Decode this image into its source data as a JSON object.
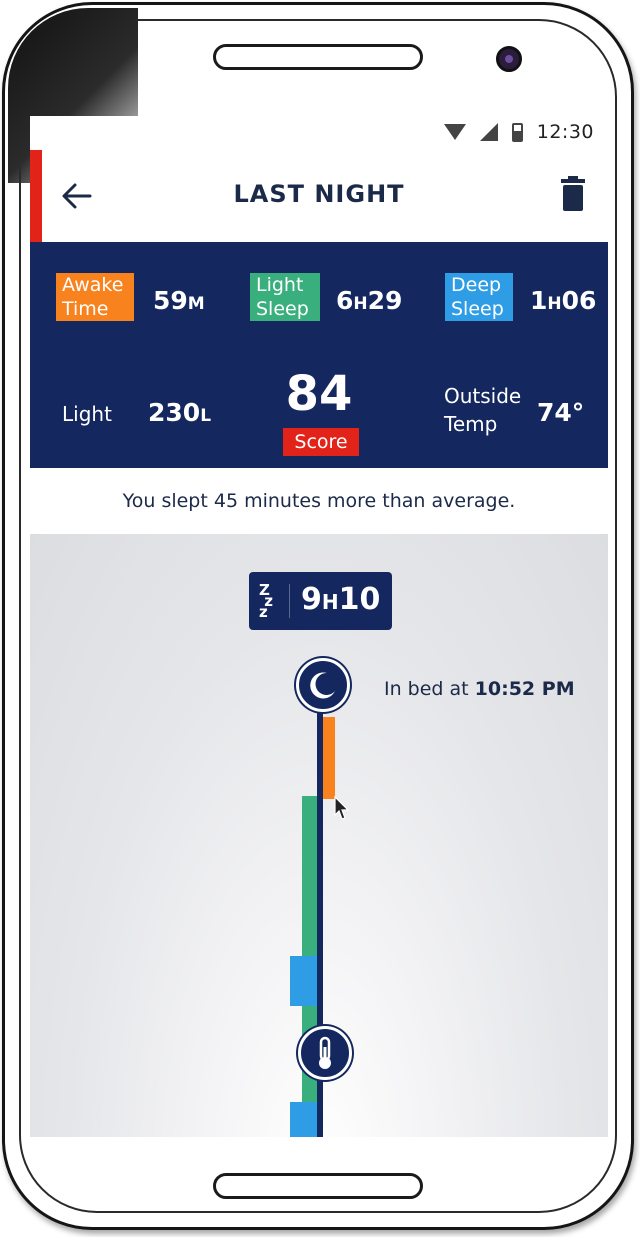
{
  "status_bar": {
    "time": "12:30"
  },
  "app_bar": {
    "title": "LAST NIGHT"
  },
  "stats": {
    "awake": {
      "label_line1": "Awake",
      "label_line2": "Time",
      "value": "59",
      "unit": "M",
      "color": "#f7821e"
    },
    "light_sleep": {
      "label_line1": "Light",
      "label_line2": "Sleep",
      "value_h": "6",
      "h_unit": "H",
      "value_m": "29",
      "color": "#3aaf7e"
    },
    "deep_sleep": {
      "label_line1": "Deep",
      "label_line2": "Sleep",
      "value_h": "1",
      "h_unit": "H",
      "value_m": "06",
      "color": "#2e9de6"
    },
    "light": {
      "label": "Light",
      "value": "230",
      "unit": "L"
    },
    "score": {
      "value": "84",
      "label": "Score"
    },
    "outside_temp": {
      "label_line1": "Outside",
      "label_line2": "Temp",
      "value": "74°"
    }
  },
  "summary_text": "You slept 45 minutes more than average.",
  "timeline": {
    "duration": {
      "hours": "9",
      "h_unit": "H",
      "minutes": "10"
    },
    "in_bed_prefix": "In bed at ",
    "in_bed_time": "10:52 PM"
  },
  "colors": {
    "navy": "#14285f",
    "accent_red": "#e2231a",
    "awake": "#f7821e",
    "light_sleep": "#3aaf7e",
    "deep_sleep": "#2e9de6"
  }
}
